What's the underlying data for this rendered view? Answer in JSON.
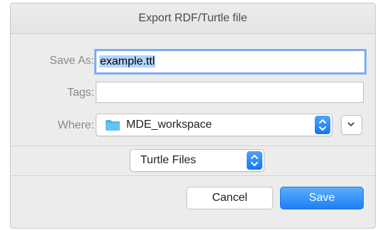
{
  "dialog": {
    "title": "Export RDF/Turtle file"
  },
  "form": {
    "save_as_label": "Save As:",
    "save_as_value": "example.ttl",
    "tags_label": "Tags:",
    "tags_value": "",
    "where_label": "Where:",
    "where_value": "MDE_workspace",
    "where_icon": "folder-icon"
  },
  "format": {
    "selected": "Turtle Files"
  },
  "buttons": {
    "cancel_label": "Cancel",
    "save_label": "Save"
  },
  "colors": {
    "accent": "#1e7ff5",
    "folder": "#4fb3e8",
    "focus_ring": "#7aaef0"
  }
}
